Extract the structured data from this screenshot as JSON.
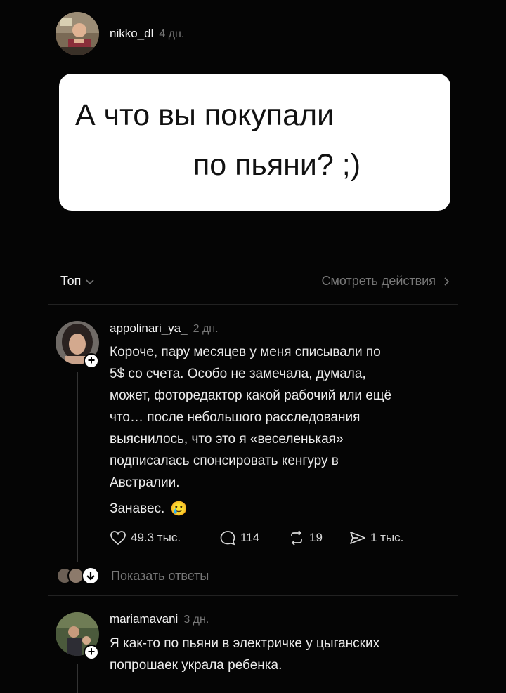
{
  "post": {
    "author": "nikko_dl",
    "time": "4 дн.",
    "avatar_icon": "user-avatar-photo",
    "question_line1": "А что вы покупали",
    "question_line2": "по пьяни? ;)"
  },
  "sort_bar": {
    "sort_label": "Топ",
    "view_activity_label": "Смотреть действия"
  },
  "comments": [
    {
      "author": "appolinari_ya_",
      "time": "2 дн.",
      "text_lines": [
        "Короче, пару месяцев у меня списывали по",
        "5$ со счета. Особо не замечала, думала,",
        "может, фоторедактор какой рабочий или ещё",
        "что… после небольшого расследования",
        "выяснилось, что это я «веселенькая»",
        "подписалась спонсировать кенгуру в",
        "Австралии."
      ],
      "last_line": "Занавес.",
      "emoji": "🥲",
      "likes": "49.3 тыс.",
      "replies": "114",
      "reposts": "19",
      "shares": "1 тыс.",
      "show_replies_label": "Показать ответы"
    },
    {
      "author": "mariamavani",
      "time": "3 дн.",
      "text_lines": [
        "Я как-то по пьяни в электричке у цыганских",
        "попрошаек украла ребенка."
      ]
    }
  ],
  "colors": {
    "background": "#050505",
    "card": "#ffffff",
    "muted": "#777777"
  }
}
